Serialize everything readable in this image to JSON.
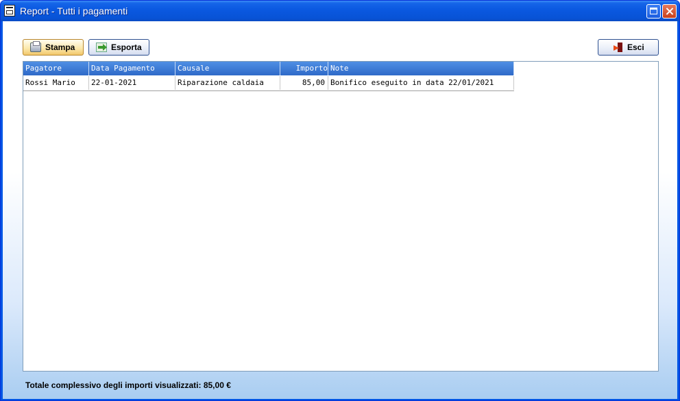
{
  "window": {
    "title": "Report - Tutti i pagamenti"
  },
  "toolbar": {
    "print_label": "Stampa",
    "export_label": "Esporta",
    "exit_label": "Esci"
  },
  "table": {
    "columns": [
      "Pagatore",
      "Data Pagamento",
      "Causale",
      "Importo",
      "Note"
    ],
    "rows": [
      [
        "Rossi Mario",
        "22-01-2021",
        "Riparazione caldaia",
        "85,00",
        "Bonifico eseguito in data 22/01/2021"
      ]
    ]
  },
  "footer": {
    "total_label": "Totale complessivo degli importi visualizzati: 85,00 €"
  },
  "colors": {
    "titlebar": "#0a58e0",
    "header": "#2f6ac8",
    "accent_button": "#f2c66a"
  }
}
